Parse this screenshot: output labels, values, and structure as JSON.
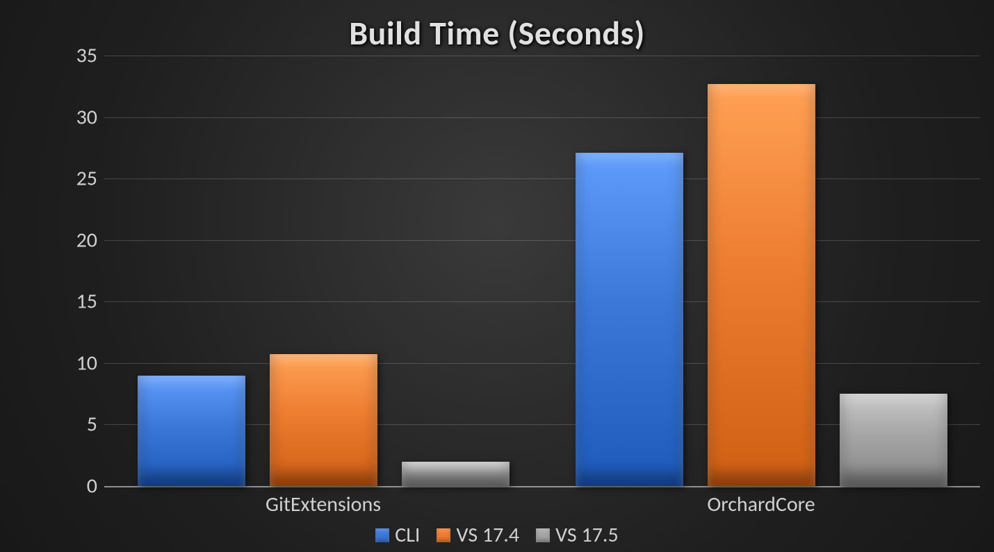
{
  "chart_data": {
    "type": "bar",
    "title": "Build Time (Seconds)",
    "xlabel": "",
    "ylabel": "",
    "categories": [
      "GitExtensions",
      "OrchardCore"
    ],
    "series": [
      {
        "name": "CLI",
        "color": "#3b78d8",
        "values": [
          9.0,
          27.1
        ]
      },
      {
        "name": "VS 17.4",
        "color": "#ed7d31",
        "values": [
          10.7,
          32.7
        ]
      },
      {
        "name": "VS 17.5",
        "color": "#a5a5a5",
        "values": [
          2.0,
          7.5
        ]
      }
    ],
    "ylim": [
      0,
      35
    ],
    "yticks": [
      0,
      5,
      10,
      15,
      20,
      25,
      30,
      35
    ]
  }
}
